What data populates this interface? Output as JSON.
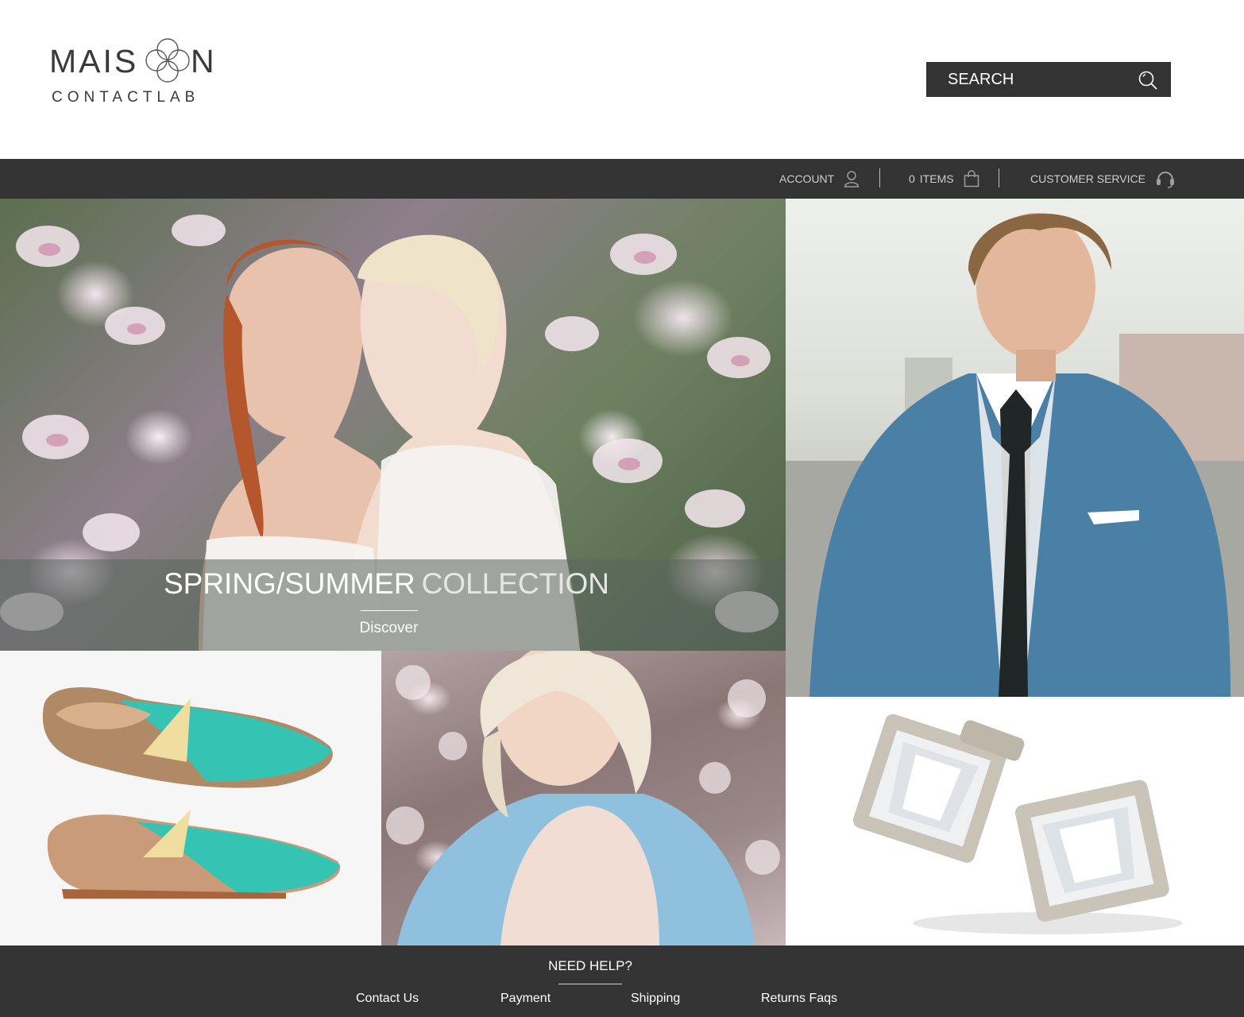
{
  "brand": {
    "logo_text_main": "MAIS",
    "logo_text_end": "N",
    "logo_text_sub": "CONTACTLAB"
  },
  "search": {
    "placeholder": "SEARCH",
    "icon": "search-icon"
  },
  "nav": {
    "account_label": "ACCOUNT",
    "account_icon": "user-icon",
    "cart_count": "0",
    "cart_label": "ITEMS",
    "cart_icon": "shopping-bag-icon",
    "service_label": "CUSTOMER SERVICE",
    "service_icon": "headset-icon"
  },
  "hero": {
    "title_bold": "SPRING/SUMMER",
    "title_light": "COLLECTION",
    "link": "Discover"
  },
  "footer": {
    "title": "NEED HELP?",
    "links": [
      "Contact Us",
      "Payment",
      "Shipping",
      "Returns Faqs"
    ]
  },
  "colors": {
    "dark_bar": "#333333",
    "nav_text": "#cfcfcf",
    "white": "#ffffff"
  }
}
